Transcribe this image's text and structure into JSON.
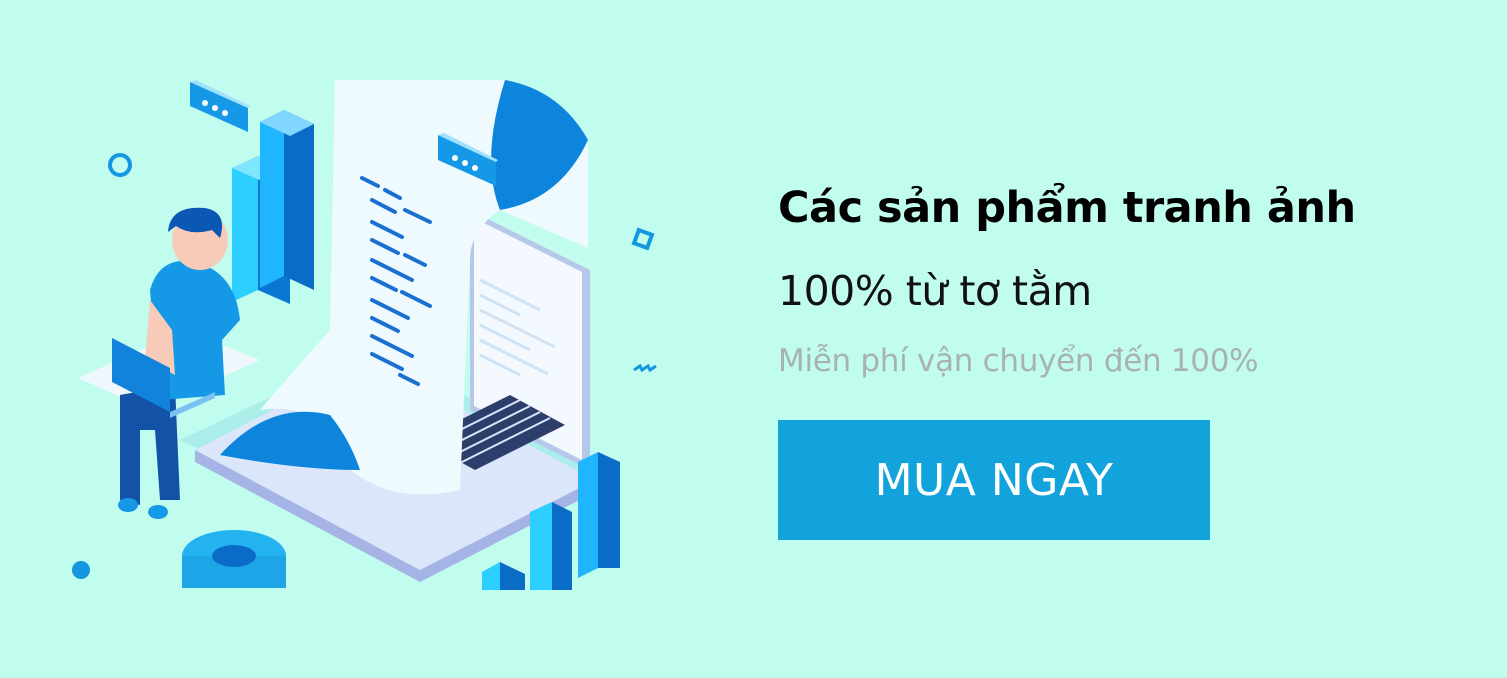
{
  "banner": {
    "headline": "Các sản phẩm tranh ảnh",
    "subtitle": "100% từ tơ tằm",
    "note": "Miễn phí vận chuyển đến 100%",
    "cta_label": "MUA NGAY"
  },
  "illustration": {
    "icons": [
      "chat-bubble-icon",
      "bar-chart-icon",
      "laptop-icon",
      "receipt-scroll-icon",
      "person-icon",
      "ring-chart-icon"
    ]
  },
  "colors": {
    "background": "#c0fdee",
    "accent": "#12a3dc",
    "headline": "#000000",
    "note": "#a9b2b2"
  }
}
